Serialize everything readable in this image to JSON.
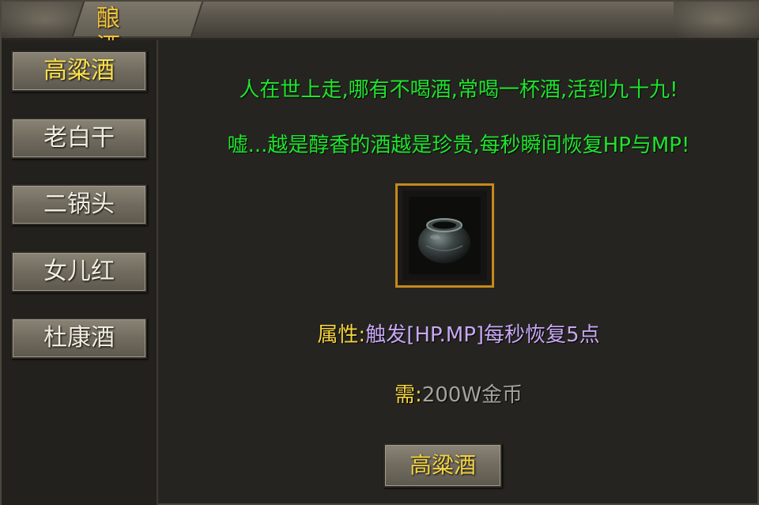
{
  "title": "酿 酒",
  "sidebar": {
    "items": [
      {
        "label": "高粱酒",
        "active": true
      },
      {
        "label": "老白干",
        "active": false
      },
      {
        "label": "二锅头",
        "active": false
      },
      {
        "label": "女儿红",
        "active": false
      },
      {
        "label": "杜康酒",
        "active": false
      }
    ]
  },
  "main": {
    "line1": "人在世上走,哪有不喝酒,常喝一杯酒,活到九十九!",
    "line2": "嘘...越是醇香的酒越是珍贵,每秒瞬间恢复HP与MP!",
    "item_icon": "wine-jar-icon",
    "property_label": "属性:",
    "property_value": "触发[HP.MP]每秒恢复5点",
    "cost_label": "需:",
    "cost_value": "200W金币",
    "action_label": "高粱酒"
  },
  "colors": {
    "text_green": "#1fe42d",
    "label_yellow": "#f4d340",
    "value_purple": "#c7a8f4",
    "frame_gold": "#c48a1c"
  }
}
